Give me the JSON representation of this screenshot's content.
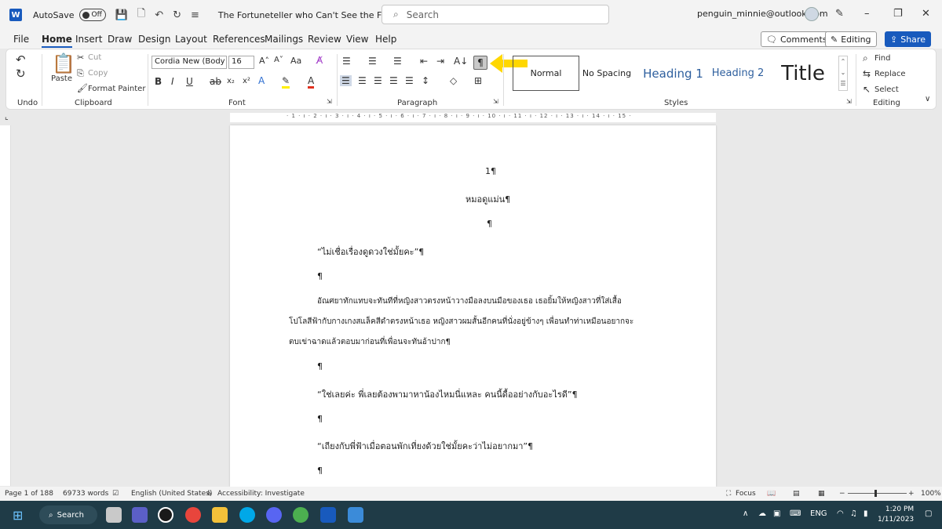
{
  "titlebar": {
    "app_letter": "W",
    "autosave_label": "AutoSave",
    "autosave_state": "Off",
    "document_title": "The Fortuneteller who Can't See the Future(RaW)",
    "search_placeholder": "Search",
    "account": "penguin_minnie@outlook.com"
  },
  "menu": {
    "tabs": [
      "File",
      "Home",
      "Insert",
      "Draw",
      "Design",
      "Layout",
      "References",
      "Mailings",
      "Review",
      "View",
      "Help"
    ],
    "comments": "Comments",
    "editing": "Editing",
    "share": "Share"
  },
  "ribbon": {
    "groups": [
      "Undo",
      "Clipboard",
      "Font",
      "Paragraph",
      "Styles",
      "Editing"
    ],
    "clipboard": {
      "paste": "Paste",
      "cut": "Cut",
      "copy": "Copy",
      "format_painter": "Format Painter"
    },
    "font": {
      "name": "Cordia New (Body C",
      "size": "16"
    },
    "styles": [
      "Normal",
      "No Spacing",
      "Heading 1",
      "Heading 2",
      "Title"
    ],
    "editing": {
      "find": "Find",
      "replace": "Replace",
      "select": "Select"
    },
    "show_hide_symbol": "¶"
  },
  "ruler": {
    "text": "· 1 · ı · 2 · ı · 3 · ı · 4 · ı · 5 · ı · 6 · ı · 7 · ı · 8 · ı · 9 · ı · 10 · ı · 11 · ı · 12 · ı · 13 · ı · 14 · ı · 15 ·"
  },
  "document": {
    "chapter_number": "1¶",
    "chapter_title": "หมอดูแม่น¶",
    "empty_mark": "¶",
    "line1": "“ไม่เชื่อเรื่องดูดวงใช่มั้ยคะ”¶",
    "para1_line1": "อัณศยาทักแทบจะทันทีที่หญิงสาวตรงหน้าวางมือลงบนมือของเธอ เธอยิ้มให้หญิงสาวที่ใส่เสื้อ",
    "para1_line2": "โปโลสีฟ้ากับกางเกงสแล็คสีดำตรงหน้าเธอ หญิงสาวผมสั้นอีกคนที่นั่งอยู่ข้างๆ เพื่อนทำท่าเหมือนอยากจะ",
    "para1_line3": "ตบเข่าฉาดแล้วตอบมาก่อนที่เพื่อนจะทันอ้าปาก¶",
    "line2": "“ใช่เลยค่ะ พี่เลยต้องพามาหาน้องไหมนี่แหละ คนนี้ดื้ออย่างกับอะไรดี”¶",
    "line3": "“เถียงกับพี่ฟ้าเมื่อตอนพักเที่ยงด้วยใช่มั้ยคะว่าไม่อยากมา”¶"
  },
  "statusbar": {
    "page": "Page 1 of 188",
    "words": "69733 words",
    "language": "English (United States)",
    "accessibility": "Accessibility: Investigate",
    "focus": "Focus",
    "zoom": "100%"
  },
  "taskbar": {
    "search": "Search",
    "language": "ENG",
    "time": "1:20 PM",
    "date": "1/11/2023"
  },
  "colors": {
    "word_blue": "#185abd",
    "annotation_arrow": "#ffd700",
    "taskbar": "#1f3b47"
  }
}
